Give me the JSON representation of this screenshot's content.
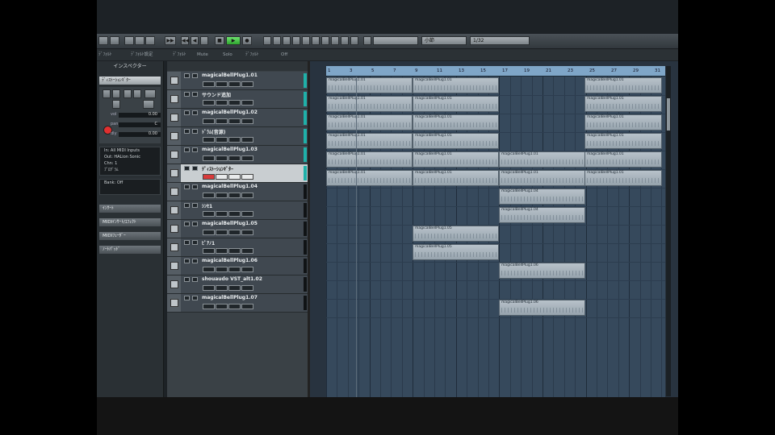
{
  "toolbar": {
    "buttons": [
      "▶▶",
      "◀◀",
      "◀",
      "▶",
      "■",
      "●"
    ],
    "fields": [
      "小節",
      "1/32"
    ]
  },
  "infoline": {
    "items": [
      "ﾃﾞﾌｫﾙﾄ",
      "ﾃﾞﾌｫﾙﾄ設定",
      "ﾃﾞﾌｫﾙﾄ",
      "Mute",
      "Solo",
      "ﾃﾞﾌｫﾙﾄ",
      "Off"
    ]
  },
  "inspector": {
    "title": "インスペクター",
    "track_name": "ﾃﾞｨｽﾄｰｼｮﾝｷﾞﾀｰ",
    "rows": [
      {
        "label": "vol",
        "value": "0.00"
      },
      {
        "label": "pan",
        "value": "C"
      },
      {
        "label": "dly",
        "value": "0.00"
      }
    ],
    "routing": [
      "In: All MIDI Inputs",
      "Out: HALion Sonic",
      "Chn: 1",
      "ﾌﾟﾛｸﾞﾗﾑ",
      "Bank: Off"
    ],
    "sections": [
      "ｲﾝｻｰﾄ",
      "MIDIｲﾝｻｰﾄ/ｴﾌｪｸﾄ",
      "MIDIﾌｪｰﾀﾞｰ",
      "ﾉｰﾄﾊﾟｯﾄﾞ"
    ]
  },
  "tracks": [
    {
      "name": "magicalBellPlug1.01",
      "selected": false,
      "meter": true
    },
    {
      "name": "サウンド追加",
      "selected": false,
      "meter": true
    },
    {
      "name": "magicalBellPlug1.02",
      "selected": false,
      "meter": true
    },
    {
      "name": "ﾄﾞﾗﾑ(音源)",
      "selected": false,
      "meter": true
    },
    {
      "name": "magicalBellPlug1.03",
      "selected": false,
      "meter": true
    },
    {
      "name": "ﾃﾞｨｽﾄｰｼｮﾝｷﾞﾀｰ",
      "selected": true,
      "meter": true
    },
    {
      "name": "magicalBellPlug1.04",
      "selected": false,
      "meter": false
    },
    {
      "name": "ｼﾝｾ1",
      "selected": false,
      "meter": false
    },
    {
      "name": "magicalBellPlug1.05",
      "selected": false,
      "meter": false
    },
    {
      "name": "ﾋﾟｱﾉ1",
      "selected": false,
      "meter": false
    },
    {
      "name": "magicalBellPlug1.06",
      "selected": false,
      "meter": false
    },
    {
      "name": "shouaudo VST_alt1.02",
      "selected": false,
      "meter": false
    },
    {
      "name": "magicalBellPlug1.07",
      "selected": false,
      "meter": false
    }
  ],
  "ruler": {
    "marks": [
      "1",
      "3",
      "5",
      "7",
      "9",
      "11",
      "13",
      "15",
      "17",
      "19",
      "21",
      "23",
      "25",
      "27",
      "29",
      "31"
    ]
  },
  "parts": [
    {
      "lane": 0,
      "label": "magicalBellPlug1.01"
    },
    {
      "lane": 0,
      "label": "magicalBellPlug1.01"
    },
    {
      "lane": 0,
      "label": "magicalBellPlug1.01"
    },
    {
      "lane": 1,
      "label": "magicalBellPlug1.01"
    },
    {
      "lane": 1,
      "label": "magicalBellPlug1.01"
    },
    {
      "lane": 1,
      "label": "magicalBellPlug1.01"
    },
    {
      "lane": 2,
      "label": "magicalBellPlug1.01"
    },
    {
      "lane": 2,
      "label": "magicalBellPlug1.01"
    },
    {
      "lane": 2,
      "label": "magicalBellPlug1.01"
    },
    {
      "lane": 3,
      "label": "magicalBellPlug1.01"
    },
    {
      "lane": 3,
      "label": "magicalBellPlug1.01"
    },
    {
      "lane": 3,
      "label": "magicalBellPlug1.01"
    },
    {
      "lane": 4,
      "label": "magicalBellPlug1.01"
    },
    {
      "lane": 4,
      "label": "magicalBellPlug1.01"
    },
    {
      "lane": 4,
      "label": "magicalBellPlug1.01"
    },
    {
      "lane": 4,
      "label": "magicalBellPlug1.01"
    },
    {
      "lane": 5,
      "label": "magicalBellPlug1.01"
    },
    {
      "lane": 5,
      "label": "magicalBellPlug1.01"
    },
    {
      "lane": 5,
      "label": "magicalBellPlug1.01"
    },
    {
      "lane": 5,
      "label": "magicalBellPlug1.01"
    },
    {
      "lane": 6,
      "label": "magicalBellPlug1.04"
    },
    {
      "lane": 7,
      "label": "magicalBellPlug1.04"
    },
    {
      "lane": 8,
      "label": "magicalBellPlug1.05"
    },
    {
      "lane": 9,
      "label": "magicalBellPlug1.05"
    },
    {
      "lane": 10,
      "label": "magicalBellPlug1.06"
    },
    {
      "lane": 12,
      "label": "magicalBellPlug1.06"
    }
  ]
}
